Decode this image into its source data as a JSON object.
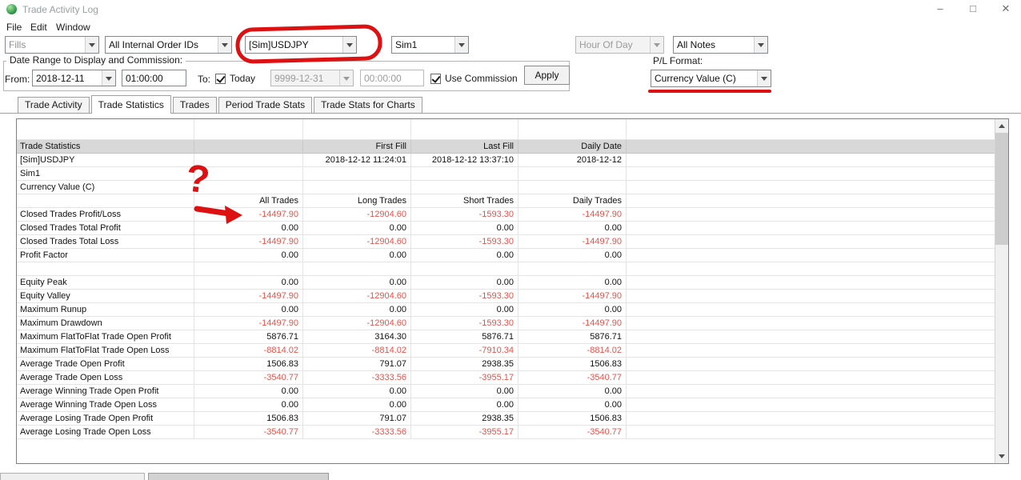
{
  "window": {
    "title": "Trade Activity Log",
    "icons": {
      "minimize": "–",
      "maximize": "□",
      "close": "✕"
    }
  },
  "menu": {
    "items": [
      "File",
      "Edit",
      "Window"
    ]
  },
  "filters": {
    "fills": "Fills",
    "order_ids": "All Internal Order IDs",
    "symbol": "[Sim]USDJPY",
    "account": "Sim1",
    "hour_of_day": "Hour Of Day",
    "notes": "All Notes"
  },
  "date_range": {
    "group_label": "Date Range to Display and Commission:",
    "from_label": "From:",
    "from_date": "2018-12-11",
    "from_time": "01:00:00",
    "to_label": "To:",
    "today_label": "Today",
    "to_date": "9999-12-31",
    "to_time": "00:00:00",
    "use_commission_label": "Use Commission",
    "apply_label": "Apply"
  },
  "pl_format": {
    "label": "P/L Format:",
    "value": "Currency Value (C)"
  },
  "tabs": [
    {
      "label": "Trade Activity",
      "active": false
    },
    {
      "label": "Trade Statistics",
      "active": true
    },
    {
      "label": "Trades",
      "active": false
    },
    {
      "label": "Period Trade Stats",
      "active": false
    },
    {
      "label": "Trade Stats for Charts",
      "active": false
    }
  ],
  "table": {
    "rows": [
      {
        "type": "spacer",
        "cells": [
          "",
          "",
          "",
          "",
          ""
        ]
      },
      {
        "type": "header",
        "cells": [
          "Trade Statistics",
          "",
          "First Fill",
          "Last Fill",
          "Daily Date"
        ]
      },
      {
        "type": "info",
        "cells": [
          "[Sim]USDJPY",
          "",
          "2018-12-12  11:24:01",
          "2018-12-12  13:37:10",
          "2018-12-12"
        ]
      },
      {
        "type": "info",
        "cells": [
          "Sim1",
          "",
          "",
          "",
          ""
        ]
      },
      {
        "type": "info",
        "cells": [
          "Currency Value (C)",
          "",
          "",
          "",
          ""
        ]
      },
      {
        "type": "colhead",
        "cells": [
          "",
          "All Trades",
          "Long Trades",
          "Short Trades",
          "Daily Trades"
        ]
      },
      {
        "type": "data",
        "cells": [
          "Closed Trades Profit/Loss",
          "-14497.90",
          "-12904.60",
          "-1593.30",
          "-14497.90"
        ]
      },
      {
        "type": "data",
        "cells": [
          "Closed Trades Total Profit",
          "0.00",
          "0.00",
          "0.00",
          "0.00"
        ]
      },
      {
        "type": "data",
        "cells": [
          "Closed Trades Total Loss",
          "-14497.90",
          "-12904.60",
          "-1593.30",
          "-14497.90"
        ]
      },
      {
        "type": "data",
        "cells": [
          "Profit Factor",
          "0.00",
          "0.00",
          "0.00",
          "0.00"
        ]
      },
      {
        "type": "data",
        "cells": [
          "",
          "",
          "",
          "",
          ""
        ]
      },
      {
        "type": "data",
        "cells": [
          "Equity Peak",
          "0.00",
          "0.00",
          "0.00",
          "0.00"
        ]
      },
      {
        "type": "data",
        "cells": [
          "Equity Valley",
          "-14497.90",
          "-12904.60",
          "-1593.30",
          "-14497.90"
        ]
      },
      {
        "type": "data",
        "cells": [
          "Maximum Runup",
          "0.00",
          "0.00",
          "0.00",
          "0.00"
        ]
      },
      {
        "type": "data",
        "cells": [
          "Maximum Drawdown",
          "-14497.90",
          "-12904.60",
          "-1593.30",
          "-14497.90"
        ]
      },
      {
        "type": "data",
        "cells": [
          "Maximum FlatToFlat Trade Open Profit",
          "5876.71",
          "3164.30",
          "5876.71",
          "5876.71"
        ]
      },
      {
        "type": "data",
        "cells": [
          "Maximum FlatToFlat Trade Open Loss",
          "-8814.02",
          "-8814.02",
          "-7910.34",
          "-8814.02"
        ]
      },
      {
        "type": "data",
        "cells": [
          "Average Trade Open Profit",
          "1506.83",
          "791.07",
          "2938.35",
          "1506.83"
        ]
      },
      {
        "type": "data",
        "cells": [
          "Average Trade Open Loss",
          "-3540.77",
          "-3333.56",
          "-3955.17",
          "-3540.77"
        ]
      },
      {
        "type": "data",
        "cells": [
          "Average Winning Trade Open Profit",
          "0.00",
          "0.00",
          "0.00",
          "0.00"
        ]
      },
      {
        "type": "data",
        "cells": [
          "Average Winning Trade Open Loss",
          "0.00",
          "0.00",
          "0.00",
          "0.00"
        ]
      },
      {
        "type": "data",
        "cells": [
          "Average Losing Trade Open Profit",
          "1506.83",
          "791.07",
          "2938.35",
          "1506.83"
        ]
      },
      {
        "type": "data",
        "cells": [
          "Average Losing Trade Open Loss",
          "-3540.77",
          "-3333.56",
          "-3955.17",
          "-3540.77"
        ]
      }
    ]
  },
  "annotations": {
    "question_mark": "?",
    "color": "#dd1111"
  },
  "colors": {
    "negative": "#e0564e",
    "header_bg": "#d8d8d8"
  }
}
